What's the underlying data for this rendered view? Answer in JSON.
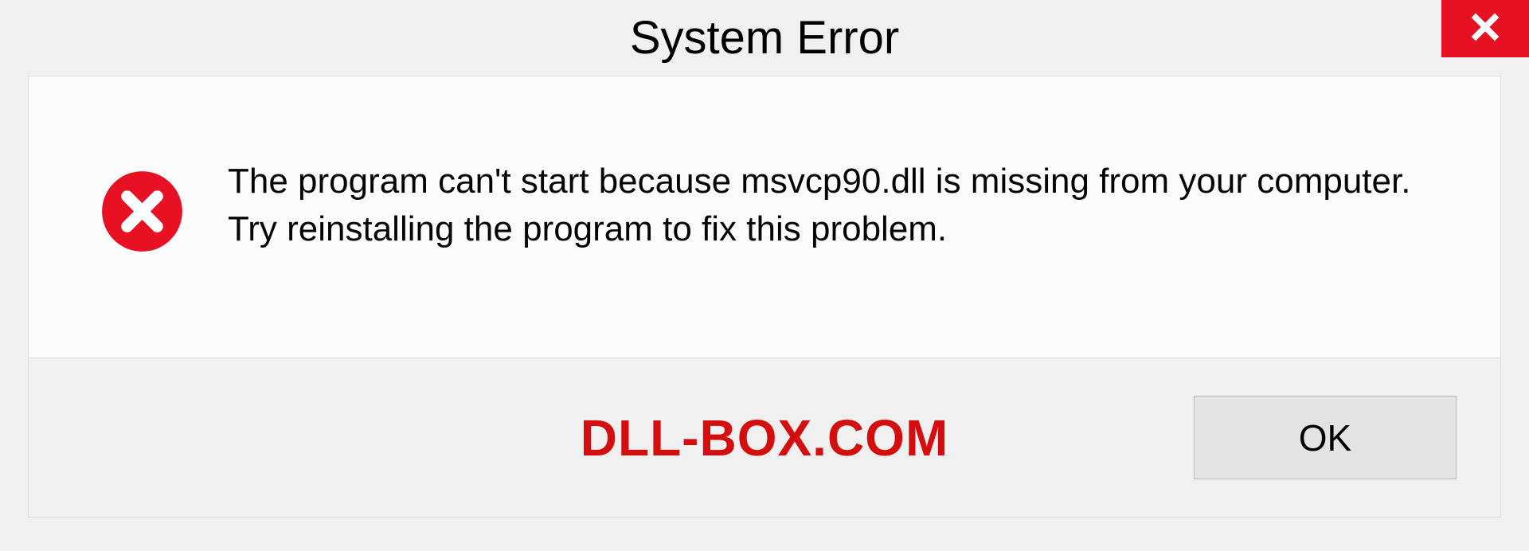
{
  "dialog": {
    "title": "System Error",
    "message": "The program can't start because msvcp90.dll is missing from your computer. Try reinstalling the program to fix this problem.",
    "ok_label": "OK"
  },
  "watermark": "DLL-BOX.COM"
}
